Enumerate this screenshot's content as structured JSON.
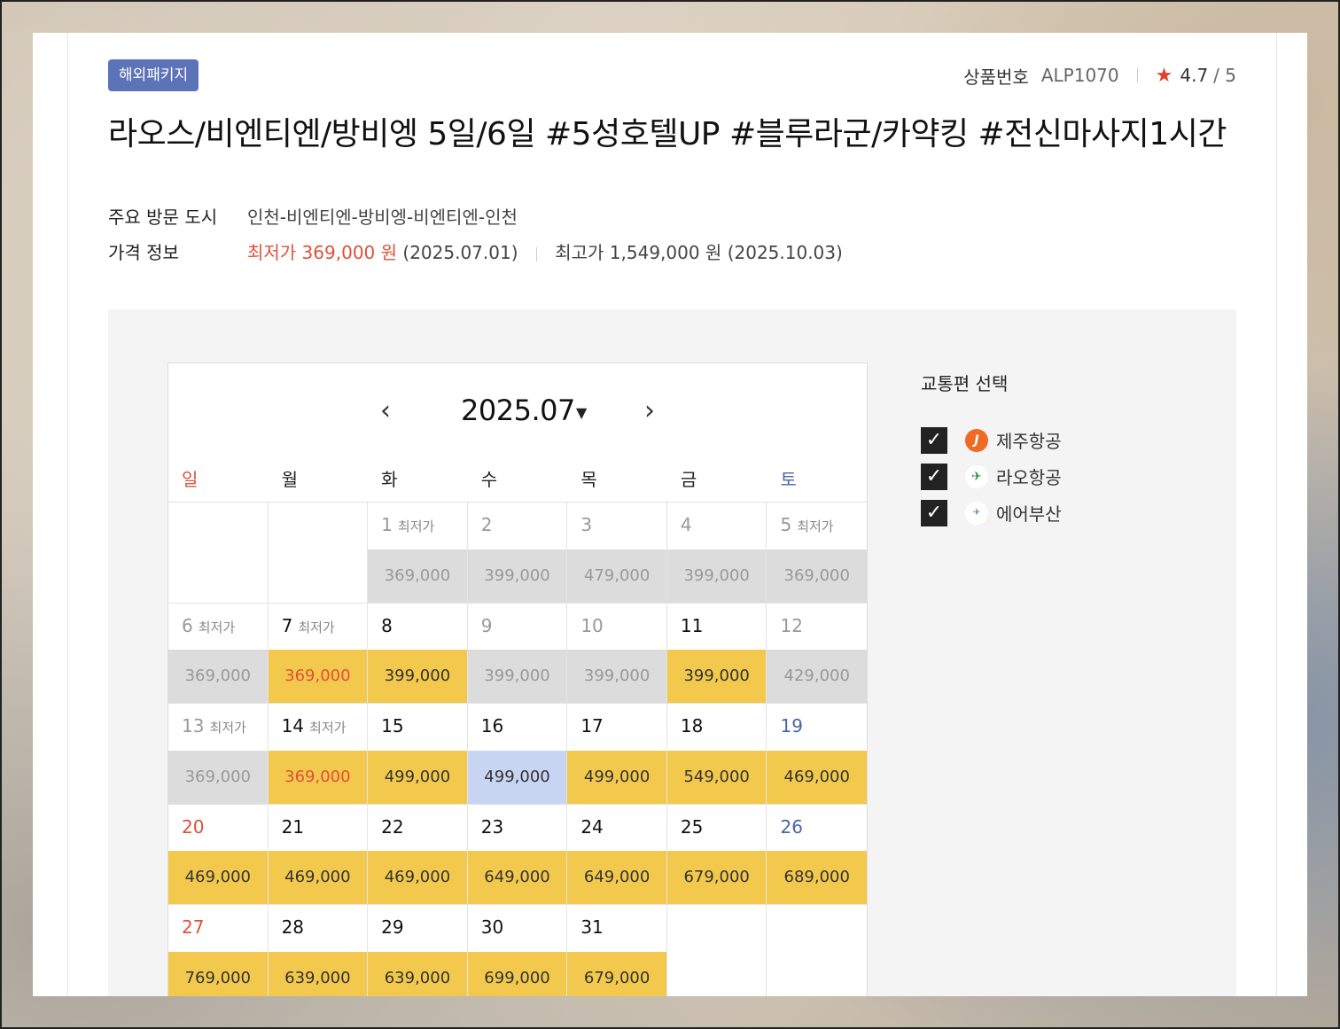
{
  "badge": "해외패키지",
  "product": {
    "code_label": "상품번호",
    "code": "ALP1070",
    "rating": "4.7",
    "rating_max": "/ 5"
  },
  "title": "라오스/비엔티엔/방비엥 5일/6일 #5성호텔UP #블루라군/카약킹 #전신마사지1시간",
  "cities": {
    "label": "주요 방문 도시",
    "value": "인천-비엔티엔-방비엥-비엔티엔-인천"
  },
  "price_info": {
    "label": "가격 정보",
    "low": "최저가 369,000 원",
    "low_date": "(2025.07.01)",
    "high": "최고가 1,549,000 원 (2025.10.03)"
  },
  "calendar": {
    "month": "2025.07",
    "prev_icon": "‹",
    "next_icon": "›",
    "caret_icon": "▼",
    "weekdays": [
      "일",
      "월",
      "화",
      "수",
      "목",
      "금",
      "토"
    ],
    "lowest_tag": "최저가",
    "weeks": [
      [
        {
          "day": "",
          "price": ""
        },
        {
          "day": "",
          "price": ""
        },
        {
          "day": "1",
          "tag": true,
          "price": "369,000",
          "style": "gray",
          "past": true
        },
        {
          "day": "2",
          "price": "399,000",
          "style": "gray",
          "past": true
        },
        {
          "day": "3",
          "price": "479,000",
          "style": "gray",
          "past": true
        },
        {
          "day": "4",
          "price": "399,000",
          "style": "gray",
          "past": true
        },
        {
          "day": "5",
          "tag": true,
          "price": "369,000",
          "style": "gray",
          "past": true
        }
      ],
      [
        {
          "day": "6",
          "tag": true,
          "price": "369,000",
          "style": "gray",
          "past": true
        },
        {
          "day": "7",
          "tag": true,
          "price": "369,000",
          "style": "yellow low"
        },
        {
          "day": "8",
          "price": "399,000",
          "style": "yellow"
        },
        {
          "day": "9",
          "price": "399,000",
          "style": "gray",
          "past": true
        },
        {
          "day": "10",
          "price": "399,000",
          "style": "gray",
          "past": true
        },
        {
          "day": "11",
          "price": "399,000",
          "style": "yellow"
        },
        {
          "day": "12",
          "price": "429,000",
          "style": "gray",
          "past": true
        }
      ],
      [
        {
          "day": "13",
          "tag": true,
          "price": "369,000",
          "style": "gray",
          "past": true
        },
        {
          "day": "14",
          "tag": true,
          "price": "369,000",
          "style": "yellow low"
        },
        {
          "day": "15",
          "price": "499,000",
          "style": "yellow"
        },
        {
          "day": "16",
          "price": "499,000",
          "style": "blue"
        },
        {
          "day": "17",
          "price": "499,000",
          "style": "yellow"
        },
        {
          "day": "18",
          "price": "549,000",
          "style": "yellow"
        },
        {
          "day": "19",
          "price": "469,000",
          "style": "yellow",
          "sat": true
        }
      ],
      [
        {
          "day": "20",
          "price": "469,000",
          "style": "yellow",
          "sun": true
        },
        {
          "day": "21",
          "price": "469,000",
          "style": "yellow"
        },
        {
          "day": "22",
          "price": "469,000",
          "style": "yellow"
        },
        {
          "day": "23",
          "price": "649,000",
          "style": "yellow"
        },
        {
          "day": "24",
          "price": "649,000",
          "style": "yellow"
        },
        {
          "day": "25",
          "price": "679,000",
          "style": "yellow"
        },
        {
          "day": "26",
          "price": "689,000",
          "style": "yellow",
          "sat": true
        }
      ],
      [
        {
          "day": "27",
          "price": "769,000",
          "style": "yellow",
          "sun": true
        },
        {
          "day": "28",
          "price": "639,000",
          "style": "yellow"
        },
        {
          "day": "29",
          "price": "639,000",
          "style": "yellow"
        },
        {
          "day": "30",
          "price": "699,000",
          "style": "yellow"
        },
        {
          "day": "31",
          "price": "679,000",
          "style": "yellow"
        },
        {
          "day": "",
          "price": ""
        },
        {
          "day": "",
          "price": ""
        }
      ]
    ]
  },
  "transport": {
    "title": "교통편 선택",
    "airlines": [
      {
        "name": "제주항공",
        "logo": "jeju",
        "logo_text": "J",
        "checked": true
      },
      {
        "name": "라오항공",
        "logo": "lao",
        "logo_text": "✈",
        "checked": true
      },
      {
        "name": "에어부산",
        "logo": "busan",
        "logo_text": "✈",
        "checked": true
      }
    ]
  },
  "colors": {
    "accent_red": "#e0503a",
    "badge_blue": "#5c73b8",
    "available_yellow": "#f2c94c",
    "past_gray": "#dcdcdc",
    "selected_blue": "#c7d4f2"
  }
}
